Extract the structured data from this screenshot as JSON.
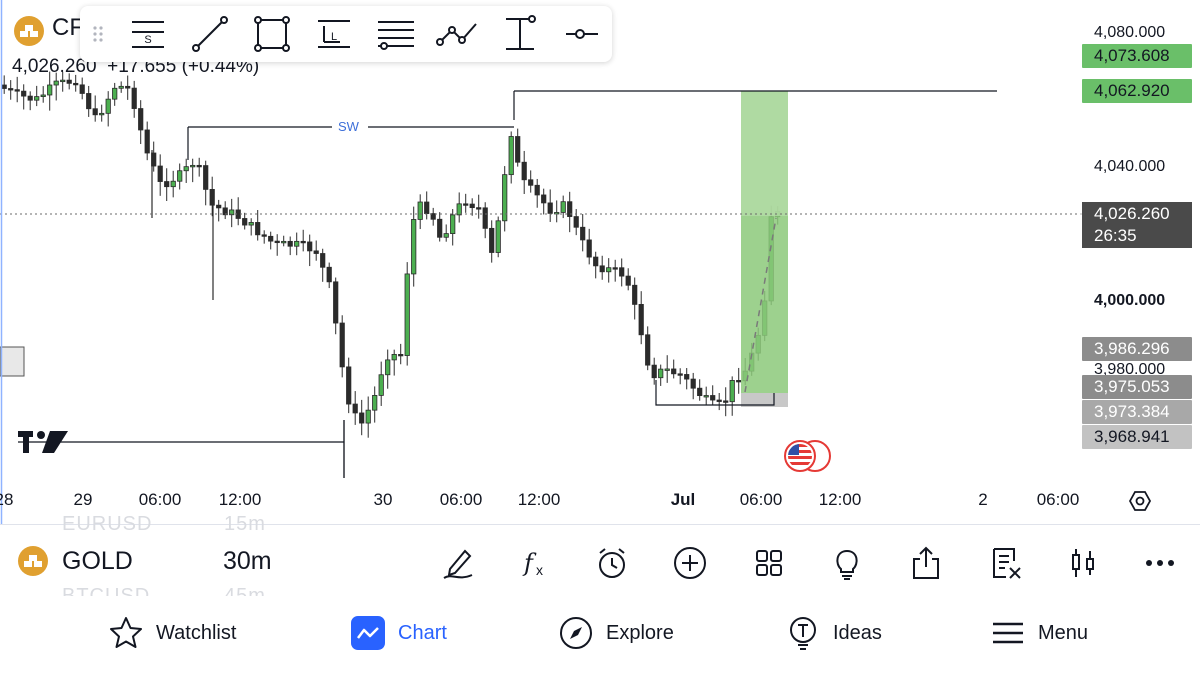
{
  "symbol": {
    "short": "CF",
    "name": "GOLD",
    "interval": "30m"
  },
  "ohlc": {
    "price": "4,026.260",
    "change": "+17.655",
    "change_pct": "(+0.44%)"
  },
  "ghost_rows": {
    "top": "EURUSD",
    "top_interval": "15m",
    "bottom": "BTCUSD",
    "bottom_interval": "45m"
  },
  "price_scale": {
    "ticks": [
      "4,080.000",
      "4,040.000",
      "4,000.000",
      "3,980.000"
    ],
    "tags": {
      "target_upper": "4,073.608",
      "target": "4,062.920",
      "current": "4,026.260",
      "countdown": "26:35",
      "entry_upper": "3,986.296",
      "entry": "3,975.053",
      "stop": "3,973.384",
      "low": "3,968.941"
    }
  },
  "time_axis": [
    "28",
    "29",
    "06:00",
    "12:00",
    "30",
    "06:00",
    "12:00",
    "Jul",
    "06:00",
    "12:00",
    "2",
    "06:00"
  ],
  "annotations": {
    "sweep": "SW"
  },
  "drawing_toolbar": [
    "drag-handle-icon",
    "fib-settings-icon",
    "trend-line-icon",
    "rectangle-icon",
    "long-position-icon",
    "horizontal-lines-icon",
    "path-icon",
    "vertical-range-icon",
    "horizontal-ray-icon"
  ],
  "bottom_toolbar": [
    "draw-icon",
    "indicators-icon",
    "alert-icon",
    "add-icon",
    "layouts-icon",
    "ideas-icon",
    "share-icon",
    "object-tree-icon",
    "chart-type-icon",
    "more-icon"
  ],
  "nav": {
    "watchlist": "Watchlist",
    "chart": "Chart",
    "explore": "Explore",
    "ideas": "Ideas",
    "menu": "Menu"
  },
  "colors": {
    "accent": "#2962ff",
    "up": "#5cb85c",
    "candle_up": "#4caf50",
    "candle_down": "#2b2b2b",
    "profit_zone": "#7fbf6f",
    "target_tag": "#6abf69",
    "current_tag": "#4a4a4a",
    "grey_tag": "#8c8c8c"
  }
}
